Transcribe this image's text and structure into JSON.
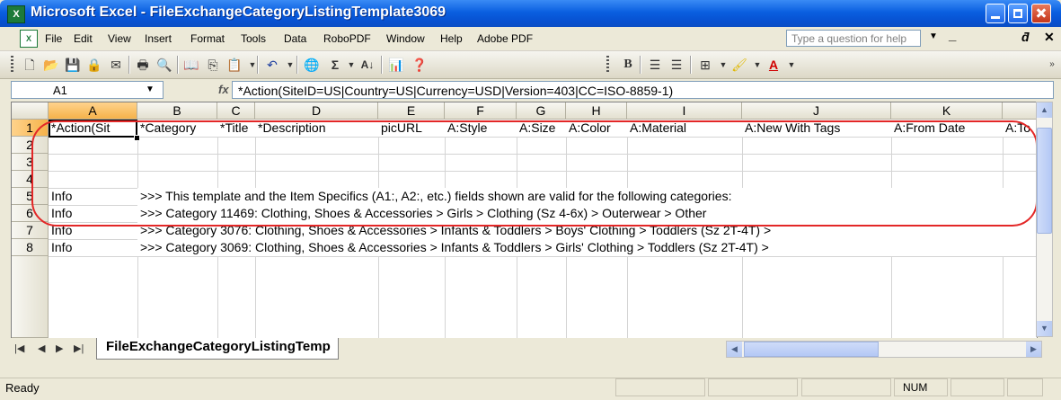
{
  "window": {
    "title": "Microsoft Excel - FileExchangeCategoryListingTemplate3069",
    "app_icon": "excel-icon"
  },
  "menu": {
    "items": [
      "File",
      "Edit",
      "View",
      "Insert",
      "Format",
      "Tools",
      "Data",
      "RoboPDF",
      "Window",
      "Help",
      "Adobe PDF"
    ]
  },
  "help": {
    "placeholder": "Type a question for help"
  },
  "formula_bar": {
    "name_box": "A1",
    "fx": "fx",
    "content": "*Action(SiteID=US|Country=US|Currency=USD|Version=403|CC=ISO-8859-1)"
  },
  "grid": {
    "columns": [
      "A",
      "B",
      "C",
      "D",
      "E",
      "F",
      "G",
      "H",
      "I",
      "J",
      "K"
    ],
    "rows": [
      "1",
      "2",
      "3",
      "4",
      "5",
      "6",
      "7",
      "8"
    ],
    "row1": [
      "*Action(Sit",
      "*Category",
      "*Title",
      "*Description",
      "picURL",
      "A:Style",
      "A:Size",
      "A:Color",
      "A:Material",
      "A:New With Tags",
      "A:From Date",
      "A:To"
    ],
    "info_label": "Info",
    "row4_text": ">>> This template and the Item Specifics (A1:, A2:, etc.) fields shown are valid for the following categories:",
    "row5_text": ">>> Category 11469: Clothing, Shoes & Accessories > Girls > Clothing (Sz 4-6x) > Outerwear > Other",
    "row6_text": ">>> Category 3076: Clothing, Shoes & Accessories > Infants & Toddlers > Boys' Clothing > Toddlers (Sz 2T-4T) >",
    "row7_text": ">>> Category 3069: Clothing, Shoes & Accessories > Infants & Toddlers > Girls' Clothing > Toddlers (Sz 2T-4T) >"
  },
  "sheet_tabs": {
    "active": "FileExchangeCategoryListingTemp"
  },
  "status": {
    "text": "Ready",
    "num": "NUM"
  },
  "colors": {
    "title_bar": "#0a5fe0",
    "highlight_ellipse": "#e32727",
    "selected_header": "#f5b24a"
  }
}
